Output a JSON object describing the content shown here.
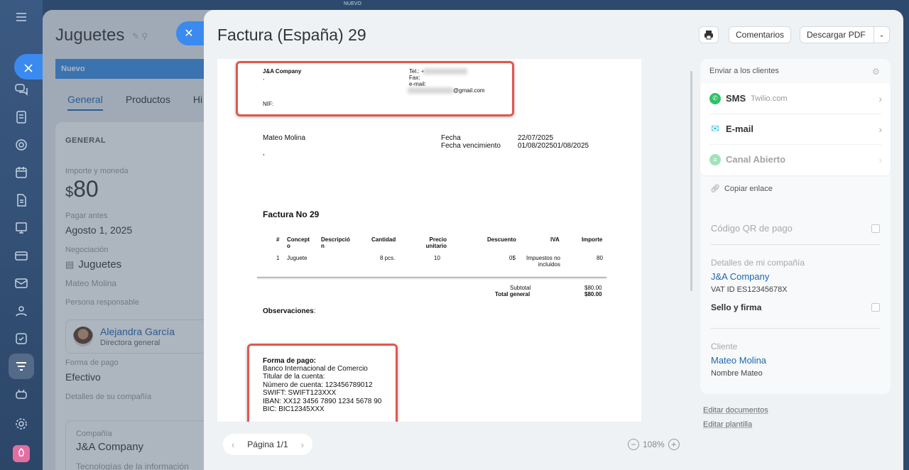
{
  "top_label": "NUEVO",
  "deal": {
    "title": "Juguetes",
    "stage": "Nuevo",
    "tabs": [
      "General",
      "Productos",
      "Hi"
    ],
    "section": "GENERAL",
    "amount_label": "Importe y moneda",
    "currency": "$",
    "amount": "80",
    "pay_before_label": "Pagar antes",
    "pay_before": "Agosto 1, 2025",
    "negotiation_label": "Negociación",
    "negotiation": "Juguetes",
    "contact": "Mateo Molina",
    "responsible_label": "Persona responsable",
    "responsible_name": "Alejandra García",
    "responsible_role": "Directora general",
    "payment_form_label": "Forma de pago",
    "payment_form": "Efectivo",
    "company_details_label": "Detalles de su compañía",
    "company_label": "Compañía",
    "company": "J&A Company",
    "company_industry": "Tecnologías de la información"
  },
  "slider": {
    "title": "Factura (España) 29",
    "comments_label": "Comentarios",
    "download_label": "Descargar PDF"
  },
  "invoice": {
    "company": "J&A Company",
    "comma": ",",
    "tel_label": "Tel.: +",
    "fax_label": "Fax:",
    "email_label": "e-mail:",
    "email_domain": "@gmail.com",
    "nif_label": "NIF:",
    "client": "Mateo Molina",
    "client_comma": ",",
    "date_label": "Fecha",
    "date": "22/07/2025",
    "due_label": "Fecha vencimiento",
    "due": "01/08/202501/08/2025",
    "heading": "Factura No 29",
    "columns": [
      "#",
      "Concept o",
      "Descripció n",
      "Cantidad",
      "Precio unitario",
      "Descuento",
      "IVA",
      "Importe"
    ],
    "row": {
      "n": "1",
      "concept": "Juguete",
      "qty": "8 pcs.",
      "price": "10",
      "discount": "0$",
      "vat": "Impuestos no incluidos",
      "amount": "80"
    },
    "subtotal_label": "Subtotal",
    "subtotal": "$80.00",
    "total_label": "Total general",
    "total": "$80.00",
    "notes_label": "Observaciones",
    "notes_colon": ":",
    "payment": {
      "title": "Forma de pago:",
      "bank": "Banco Internacional de Comercio",
      "holder": "Titular de la cuenta:",
      "account": "Número de cuenta: 123456789012",
      "swift": "SWIFT: SWIFT123XXX",
      "iban": "IBAN: XX12 3456 7890 1234 5678 90",
      "bic": "BIC: BIC12345XXX"
    }
  },
  "pager": {
    "label": "Página 1/1"
  },
  "zoom": {
    "label": "108%"
  },
  "send": {
    "heading": "Enviar a los clientes",
    "sms_label": "SMS",
    "sms_provider": "Twilio.com",
    "email_label": "E-mail",
    "open_channel_label": "Canal Abierto",
    "copy_link": "Copiar enlace"
  },
  "options": {
    "qr_label": "Código QR de pago",
    "my_company_label": "Detalles de mi compañía",
    "my_company": "J&A Company",
    "vat_id": "VAT ID ES12345678X",
    "stamp_label": "Sello y firma",
    "client_label": "Cliente",
    "client": "Mateo Molina",
    "client_name": "Nombre Mateo"
  },
  "links": {
    "edit_documents": "Editar documentos",
    "edit_template": "Editar plantilla"
  },
  "colors": {
    "accent": "#3b8af0",
    "link": "#2067b0",
    "highlight": "#e2574c",
    "sms_green": "#2fc26b",
    "email_teal": "#35bfe0"
  }
}
